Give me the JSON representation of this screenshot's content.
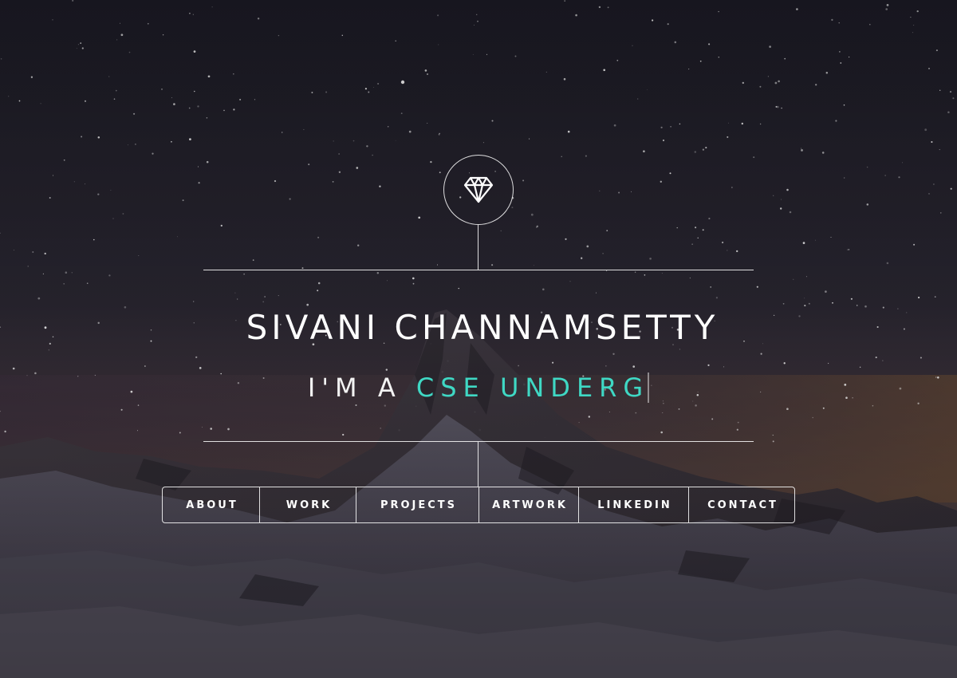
{
  "hero": {
    "name": "SIVANI CHANNAMSETTY",
    "tagline_prefix": "I'M A ",
    "tagline_typed": "CSE UNDERG"
  },
  "logo": {
    "icon": "diamond-icon"
  },
  "nav": {
    "items": [
      {
        "label": "ABOUT"
      },
      {
        "label": "WORK"
      },
      {
        "label": "PROJECTS"
      },
      {
        "label": "ARTWORK"
      },
      {
        "label": "LINKEDIN"
      },
      {
        "label": "CONTACT"
      }
    ]
  },
  "colors": {
    "accent": "#3fd8c4",
    "text": "#ffffff",
    "sky_top": "#1d1c26",
    "sky_horizon": "#4a3a3a"
  }
}
